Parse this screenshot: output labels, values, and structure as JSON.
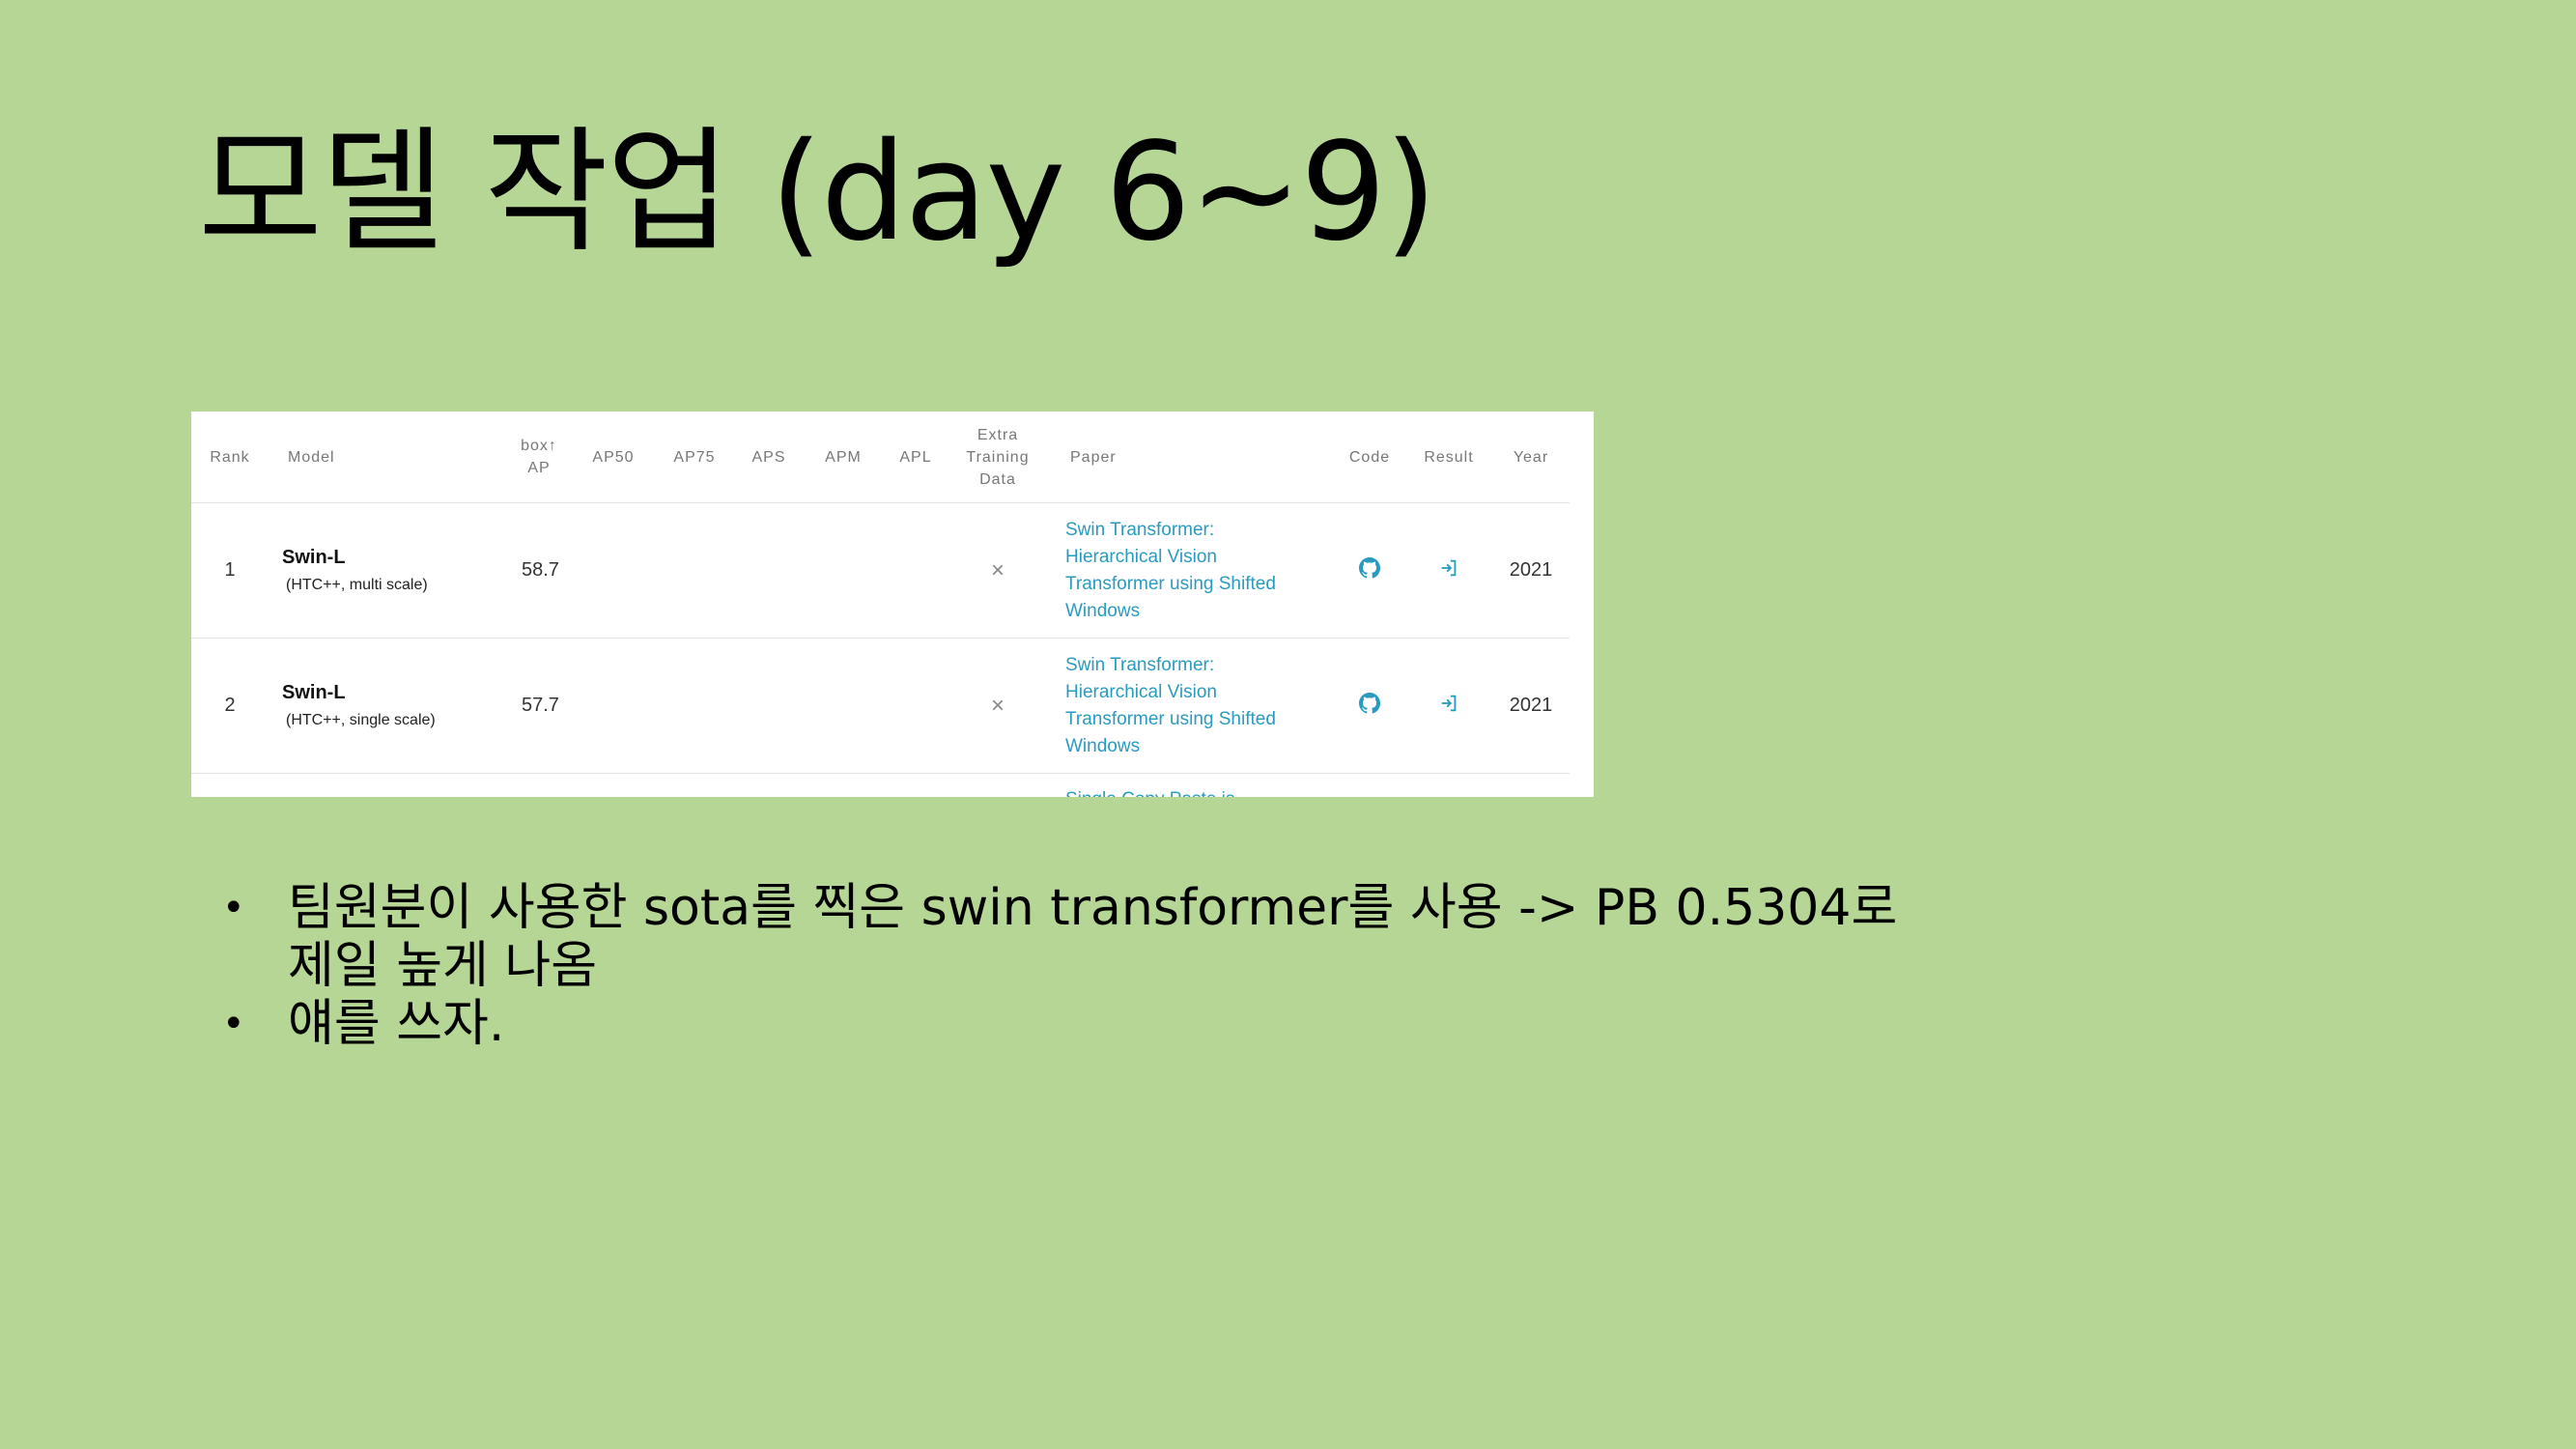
{
  "slide": {
    "title": "모델 작업 (day 6~9)"
  },
  "table": {
    "headers": {
      "rank": "Rank",
      "model": "Model",
      "box_ap": "box↑\nAP",
      "ap50": "AP50",
      "ap75": "AP75",
      "aps": "APS",
      "apm": "APM",
      "apl": "APL",
      "extra": "Extra\nTraining\nData",
      "paper": "Paper",
      "code": "Code",
      "result": "Result",
      "year": "Year"
    },
    "rows": [
      {
        "rank": "1",
        "model": "Swin-L",
        "model_detail": "(HTC++, multi scale)",
        "box_ap": "58.7",
        "extra": "×",
        "paper": "Swin Transformer: Hierarchical Vision Transformer using Shifted Windows",
        "year": "2021"
      },
      {
        "rank": "2",
        "model": "Swin-L",
        "model_detail": "(HTC++, single scale)",
        "box_ap": "57.7",
        "extra": "×",
        "paper": "Swin Transformer: Hierarchical Vision Transformer using Shifted Windows",
        "year": "2021"
      }
    ],
    "partial_row_text": "Single Copy Paste is"
  },
  "bullets": [
    "팀원분이 사용한 sota를 찍은 swin transformer를 사용 -> PB 0.5304로 제일 높게 나옴",
    "얘를 쓰자."
  ],
  "colors": {
    "background": "#b6d696",
    "link": "#2a9bc0"
  },
  "icons": {
    "code": "github-icon",
    "result": "login-arrow-icon"
  }
}
